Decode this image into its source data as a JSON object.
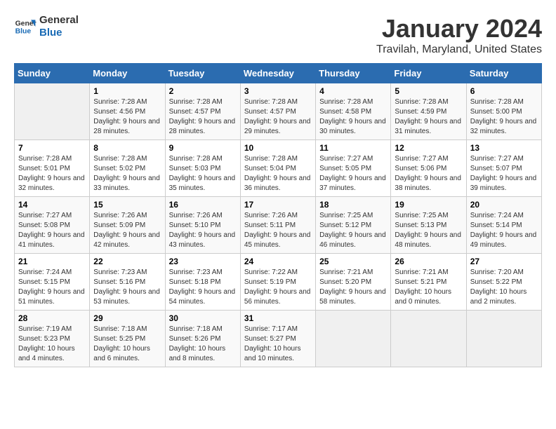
{
  "logo": {
    "line1": "General",
    "line2": "Blue"
  },
  "title": "January 2024",
  "subtitle": "Travilah, Maryland, United States",
  "headers": [
    "Sunday",
    "Monday",
    "Tuesday",
    "Wednesday",
    "Thursday",
    "Friday",
    "Saturday"
  ],
  "weeks": [
    [
      {
        "day": "",
        "sunrise": "",
        "sunset": "",
        "daylight": ""
      },
      {
        "day": "1",
        "sunrise": "Sunrise: 7:28 AM",
        "sunset": "Sunset: 4:56 PM",
        "daylight": "Daylight: 9 hours and 28 minutes."
      },
      {
        "day": "2",
        "sunrise": "Sunrise: 7:28 AM",
        "sunset": "Sunset: 4:57 PM",
        "daylight": "Daylight: 9 hours and 28 minutes."
      },
      {
        "day": "3",
        "sunrise": "Sunrise: 7:28 AM",
        "sunset": "Sunset: 4:57 PM",
        "daylight": "Daylight: 9 hours and 29 minutes."
      },
      {
        "day": "4",
        "sunrise": "Sunrise: 7:28 AM",
        "sunset": "Sunset: 4:58 PM",
        "daylight": "Daylight: 9 hours and 30 minutes."
      },
      {
        "day": "5",
        "sunrise": "Sunrise: 7:28 AM",
        "sunset": "Sunset: 4:59 PM",
        "daylight": "Daylight: 9 hours and 31 minutes."
      },
      {
        "day": "6",
        "sunrise": "Sunrise: 7:28 AM",
        "sunset": "Sunset: 5:00 PM",
        "daylight": "Daylight: 9 hours and 32 minutes."
      }
    ],
    [
      {
        "day": "7",
        "sunrise": "Sunrise: 7:28 AM",
        "sunset": "Sunset: 5:01 PM",
        "daylight": "Daylight: 9 hours and 32 minutes."
      },
      {
        "day": "8",
        "sunrise": "Sunrise: 7:28 AM",
        "sunset": "Sunset: 5:02 PM",
        "daylight": "Daylight: 9 hours and 33 minutes."
      },
      {
        "day": "9",
        "sunrise": "Sunrise: 7:28 AM",
        "sunset": "Sunset: 5:03 PM",
        "daylight": "Daylight: 9 hours and 35 minutes."
      },
      {
        "day": "10",
        "sunrise": "Sunrise: 7:28 AM",
        "sunset": "Sunset: 5:04 PM",
        "daylight": "Daylight: 9 hours and 36 minutes."
      },
      {
        "day": "11",
        "sunrise": "Sunrise: 7:27 AM",
        "sunset": "Sunset: 5:05 PM",
        "daylight": "Daylight: 9 hours and 37 minutes."
      },
      {
        "day": "12",
        "sunrise": "Sunrise: 7:27 AM",
        "sunset": "Sunset: 5:06 PM",
        "daylight": "Daylight: 9 hours and 38 minutes."
      },
      {
        "day": "13",
        "sunrise": "Sunrise: 7:27 AM",
        "sunset": "Sunset: 5:07 PM",
        "daylight": "Daylight: 9 hours and 39 minutes."
      }
    ],
    [
      {
        "day": "14",
        "sunrise": "Sunrise: 7:27 AM",
        "sunset": "Sunset: 5:08 PM",
        "daylight": "Daylight: 9 hours and 41 minutes."
      },
      {
        "day": "15",
        "sunrise": "Sunrise: 7:26 AM",
        "sunset": "Sunset: 5:09 PM",
        "daylight": "Daylight: 9 hours and 42 minutes."
      },
      {
        "day": "16",
        "sunrise": "Sunrise: 7:26 AM",
        "sunset": "Sunset: 5:10 PM",
        "daylight": "Daylight: 9 hours and 43 minutes."
      },
      {
        "day": "17",
        "sunrise": "Sunrise: 7:26 AM",
        "sunset": "Sunset: 5:11 PM",
        "daylight": "Daylight: 9 hours and 45 minutes."
      },
      {
        "day": "18",
        "sunrise": "Sunrise: 7:25 AM",
        "sunset": "Sunset: 5:12 PM",
        "daylight": "Daylight: 9 hours and 46 minutes."
      },
      {
        "day": "19",
        "sunrise": "Sunrise: 7:25 AM",
        "sunset": "Sunset: 5:13 PM",
        "daylight": "Daylight: 9 hours and 48 minutes."
      },
      {
        "day": "20",
        "sunrise": "Sunrise: 7:24 AM",
        "sunset": "Sunset: 5:14 PM",
        "daylight": "Daylight: 9 hours and 49 minutes."
      }
    ],
    [
      {
        "day": "21",
        "sunrise": "Sunrise: 7:24 AM",
        "sunset": "Sunset: 5:15 PM",
        "daylight": "Daylight: 9 hours and 51 minutes."
      },
      {
        "day": "22",
        "sunrise": "Sunrise: 7:23 AM",
        "sunset": "Sunset: 5:16 PM",
        "daylight": "Daylight: 9 hours and 53 minutes."
      },
      {
        "day": "23",
        "sunrise": "Sunrise: 7:23 AM",
        "sunset": "Sunset: 5:18 PM",
        "daylight": "Daylight: 9 hours and 54 minutes."
      },
      {
        "day": "24",
        "sunrise": "Sunrise: 7:22 AM",
        "sunset": "Sunset: 5:19 PM",
        "daylight": "Daylight: 9 hours and 56 minutes."
      },
      {
        "day": "25",
        "sunrise": "Sunrise: 7:21 AM",
        "sunset": "Sunset: 5:20 PM",
        "daylight": "Daylight: 9 hours and 58 minutes."
      },
      {
        "day": "26",
        "sunrise": "Sunrise: 7:21 AM",
        "sunset": "Sunset: 5:21 PM",
        "daylight": "Daylight: 10 hours and 0 minutes."
      },
      {
        "day": "27",
        "sunrise": "Sunrise: 7:20 AM",
        "sunset": "Sunset: 5:22 PM",
        "daylight": "Daylight: 10 hours and 2 minutes."
      }
    ],
    [
      {
        "day": "28",
        "sunrise": "Sunrise: 7:19 AM",
        "sunset": "Sunset: 5:23 PM",
        "daylight": "Daylight: 10 hours and 4 minutes."
      },
      {
        "day": "29",
        "sunrise": "Sunrise: 7:18 AM",
        "sunset": "Sunset: 5:25 PM",
        "daylight": "Daylight: 10 hours and 6 minutes."
      },
      {
        "day": "30",
        "sunrise": "Sunrise: 7:18 AM",
        "sunset": "Sunset: 5:26 PM",
        "daylight": "Daylight: 10 hours and 8 minutes."
      },
      {
        "day": "31",
        "sunrise": "Sunrise: 7:17 AM",
        "sunset": "Sunset: 5:27 PM",
        "daylight": "Daylight: 10 hours and 10 minutes."
      },
      {
        "day": "",
        "sunrise": "",
        "sunset": "",
        "daylight": ""
      },
      {
        "day": "",
        "sunrise": "",
        "sunset": "",
        "daylight": ""
      },
      {
        "day": "",
        "sunrise": "",
        "sunset": "",
        "daylight": ""
      }
    ]
  ]
}
